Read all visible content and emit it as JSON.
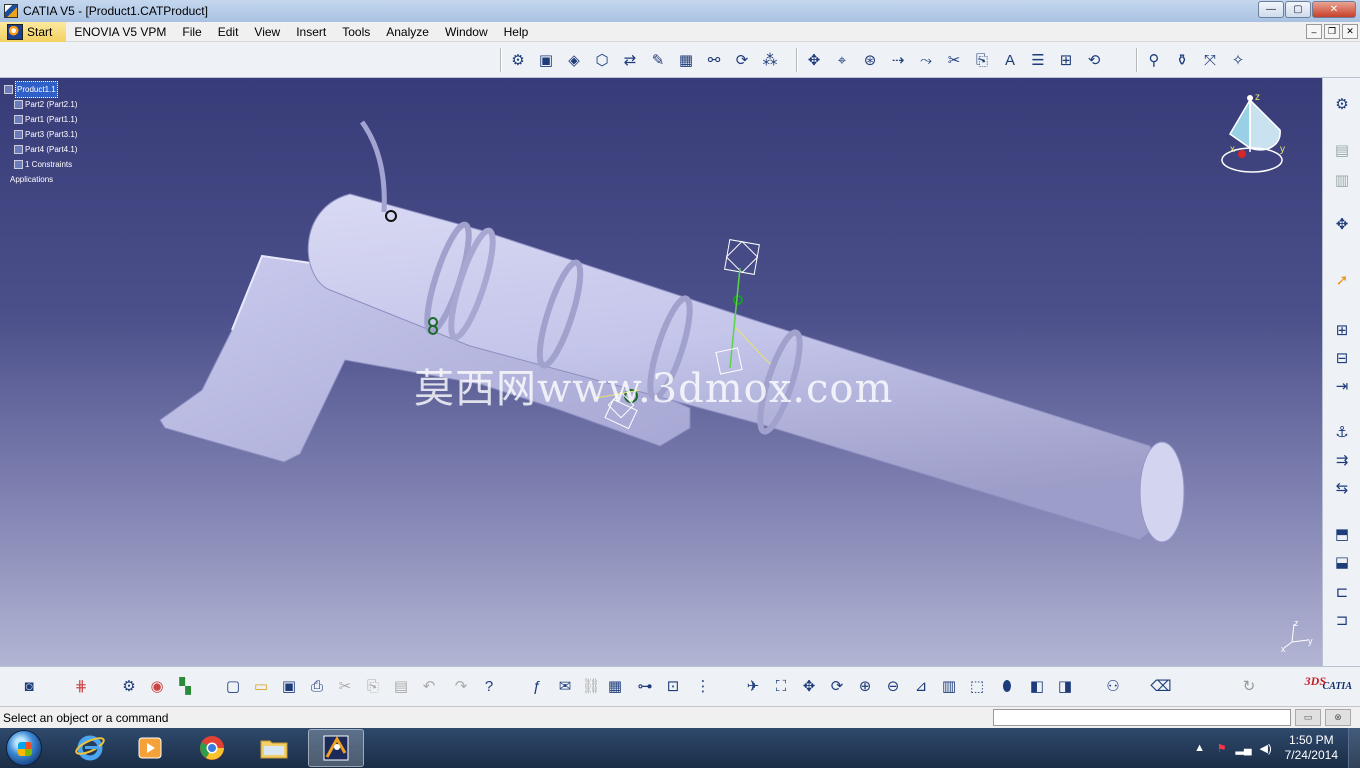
{
  "window": {
    "title": "CATIA V5 - [Product1.CATProduct]",
    "controls": {
      "minimize": "—",
      "maximize": "▢",
      "close": "✕"
    }
  },
  "menu": {
    "items": [
      "Start",
      "ENOVIA V5 VPM",
      "File",
      "Edit",
      "View",
      "Insert",
      "Tools",
      "Analyze",
      "Window",
      "Help"
    ],
    "mdi": {
      "minimize": "–",
      "restore": "❐",
      "close": "✕"
    }
  },
  "tree": {
    "root": "Product1.1",
    "children": [
      "Part2 (Part2.1)",
      "Part1 (Part1.1)",
      "Part3 (Part3.1)",
      "Part4 (Part4.1)",
      "1 Constraints"
    ],
    "last": "Applications"
  },
  "viewport": {
    "watermark": "莫西网www.3dmox.com",
    "compass_axes": {
      "z": "z",
      "x": "x",
      "y": "y"
    },
    "mini_axes": {
      "z": "z",
      "x": "x",
      "y": "y"
    }
  },
  "status": {
    "message": "Select an object or a command",
    "command_value": ""
  },
  "catia_logo": {
    "ds": "3DS",
    "text": "CATIA"
  },
  "taskbar": {
    "time": "1:50 PM",
    "date": "7/24/2014",
    "apps": [
      "internet-explorer",
      "media-player",
      "chrome",
      "file-explorer",
      "catia"
    ]
  },
  "colors": {
    "viewport_top": "#373c78",
    "viewport_bottom": "#b3b5d4",
    "part_color": "#c6c7ea",
    "accent": "#2f5fc9"
  }
}
